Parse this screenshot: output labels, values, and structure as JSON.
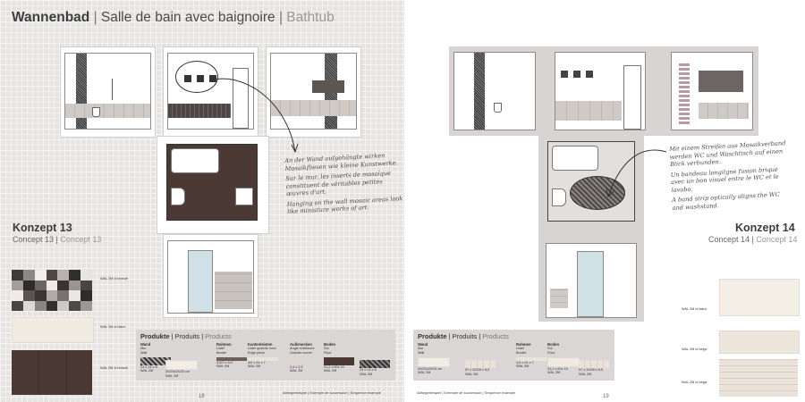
{
  "left_page": {
    "title": {
      "de": "Wannenbad",
      "fr": "Salle de bain avec baignoire",
      "en": "Bathtub"
    },
    "concept": {
      "heading": "Konzept 13",
      "fr": "Concept 13",
      "en": "Concept 13"
    },
    "notes": [
      "An der Wand aufgehängte wirken Mosaikfliesen wie kleine Kunstwerke.",
      "Sur le mur, les inserts de mosaïque constituent de véritables petites œuvres d'art.",
      "Hanging on the wall mosaic areas look like miniature works of art."
    ],
    "products": {
      "title": {
        "de": "Produkte",
        "fr": "Produits",
        "en": "Products"
      },
      "columns": [
        {
          "de": "Wand",
          "fr": "Mur",
          "en": "Wall",
          "size": "20/25x25/25 cm",
          "code": "WAL 2M"
        },
        {
          "de": "Rahmen",
          "fr": "Listel",
          "en": "Border",
          "size": "3,5/2 x 4x7",
          "code": "WAL 2M"
        },
        {
          "de": "Kantenleisten",
          "fr": "Listel quartde rond",
          "en": "Edge piece",
          "size": "3/2 x 24 x 7",
          "code": "WAL 2M"
        },
        {
          "de": "Außenecken",
          "fr": "Angle extérieure",
          "en": "Outside corner",
          "size": "2,4 x 2,5",
          "code": "WAL 2M"
        },
        {
          "de": "Boden",
          "fr": "Sol",
          "en": "Floor",
          "size": "31,2 x 60x 15",
          "code": "WAL 2M"
        }
      ],
      "extra_size": "24 x 24 x 8",
      "extra_code": "WAL 2M"
    },
    "tile_labels": [
      {
        "code": "WAL 2M",
        "name": "ct bronzé"
      },
      {
        "code": "WAL 2M",
        "name": "ct blanc"
      },
      {
        "code": "WAL 2M",
        "name": "ct bronze"
      }
    ],
    "footnote": "Abfolgebeispiel | Exemple de succession | Sequence example",
    "page_number": "18"
  },
  "right_page": {
    "concept": {
      "heading": "Konzept 14",
      "fr": "Concept 14",
      "en": "Concept 14"
    },
    "notes": [
      "Mit einem Streifen aus Mosaikverband werden WC und Waschtisch auf einen Blick verbunden.",
      "Un bandeau longilgne fusion brique avec un bon visuel entre le WC et le lavabo.",
      "A band strip optically aligns the WC and washstand."
    ],
    "products": {
      "title": {
        "de": "Produkte",
        "fr": "Produits",
        "en": "Products"
      },
      "columns": [
        {
          "de": "Wand",
          "fr": "Mur",
          "en": "Wall",
          "size": "20/25x25/25 cm",
          "code": "WAL 2M"
        },
        {
          "de": "",
          "fr": "",
          "en": "",
          "size": "57 x 20/28 x 8,5",
          "code": "WAL 2M"
        },
        {
          "de": "Rahmen",
          "fr": "Listel",
          "en": "Border",
          "size": "3,5 x 24 x 7",
          "code": "WAL 2M"
        },
        {
          "de": "Boden",
          "fr": "Sol",
          "en": "Floor",
          "size": "31,2 x 60x 15",
          "code": "WAL 2M"
        },
        {
          "de": "",
          "fr": "",
          "en": "",
          "size": "57 x 20/28 x 8,5",
          "code": "WAL 2M"
        }
      ]
    },
    "tile_labels": [
      {
        "code": "WAL 2M",
        "name": "ct blanc"
      },
      {
        "code": "WAL 2M",
        "name": "ct beige"
      },
      {
        "code": "WAL 2M",
        "name": "ct beige"
      }
    ],
    "footnote": "Abfolgebeispiel | Exemple de succession | Sequence example",
    "page_number": "19"
  },
  "colors": {
    "dark_brown": "#4a3a33",
    "mosaic_dark": "#3e3a3a",
    "cream": "#f1ece2",
    "panel_grey": "#d7d4d3"
  }
}
